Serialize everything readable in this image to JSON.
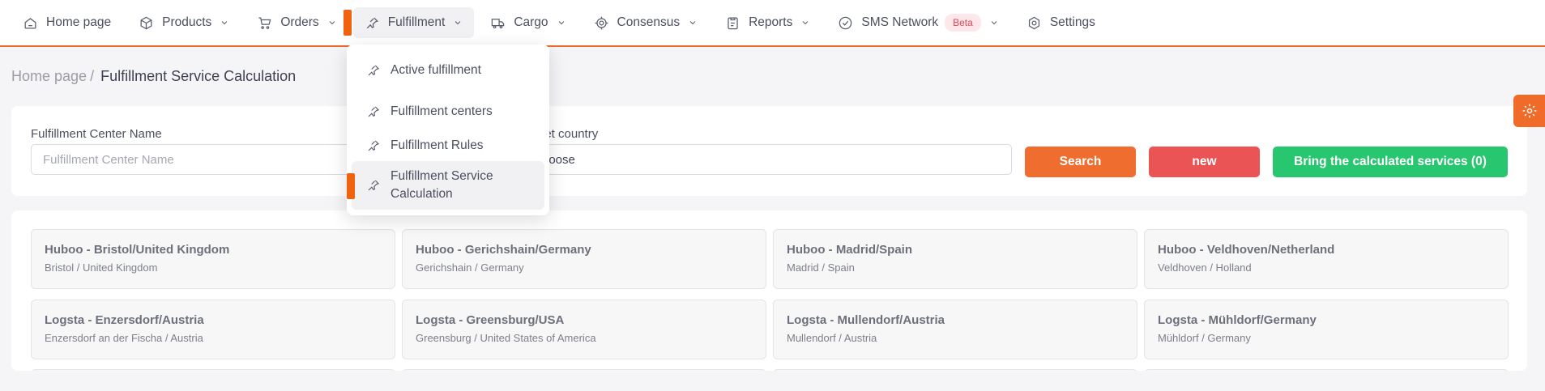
{
  "nav": {
    "items": [
      {
        "label": "Home page",
        "icon": "home-icon"
      },
      {
        "label": "Products",
        "icon": "box-icon"
      },
      {
        "label": "Orders",
        "icon": "cart-icon"
      },
      {
        "label": "Fulfillment",
        "icon": "pin-icon"
      },
      {
        "label": "Cargo",
        "icon": "truck-icon"
      },
      {
        "label": "Consensus",
        "icon": "target-icon"
      },
      {
        "label": "Reports",
        "icon": "clipboard-icon"
      },
      {
        "label": "SMS Network",
        "icon": "check-circle-icon",
        "badge": "Beta"
      },
      {
        "label": "Settings",
        "icon": "settings-icon"
      }
    ]
  },
  "dropdown": {
    "items": [
      {
        "label": "Active fulfillment"
      },
      {
        "label": "Fulfillment centers"
      },
      {
        "label": "Fulfillment Rules"
      },
      {
        "label": "Fulfillment Service Calculation"
      }
    ]
  },
  "breadcrumb": {
    "home": "Home page",
    "separator": "/",
    "current": "Fulfillment Service Calculation"
  },
  "search": {
    "center_label": "Fulfillment Center Name",
    "center_placeholder": "Fulfillment Center Name",
    "country_label": "get country",
    "country_value": "hoose",
    "search_button": "Search",
    "new_button": "new",
    "bring_button": "Bring the calculated services (0)"
  },
  "centers": [
    {
      "name": "Huboo - Bristol/United Kingdom",
      "location": "Bristol / United Kingdom"
    },
    {
      "name": "Huboo - Gerichshain/Germany",
      "location": "Gerichshain / Germany"
    },
    {
      "name": "Huboo - Madrid/Spain",
      "location": "Madrid / Spain"
    },
    {
      "name": "Huboo - Veldhoven/Netherland",
      "location": "Veldhoven / Holland"
    },
    {
      "name": "Logsta - Enzersdorf/Austria",
      "location": "Enzersdorf an der Fischa / Austria"
    },
    {
      "name": "Logsta - Greensburg/USA",
      "location": "Greensburg / United States of America"
    },
    {
      "name": "Logsta - Mullendorf/Austria",
      "location": "Mullendorf / Austria"
    },
    {
      "name": "Logsta - Mühldorf/Germany",
      "location": "Mühldorf / Germany"
    }
  ],
  "colors": {
    "accent": "#f06a2a",
    "search": "#ee6d2f",
    "new": "#ea5455",
    "bring": "#28c76f",
    "beta_bg": "#fde7ea",
    "beta_text": "#e0485a"
  }
}
